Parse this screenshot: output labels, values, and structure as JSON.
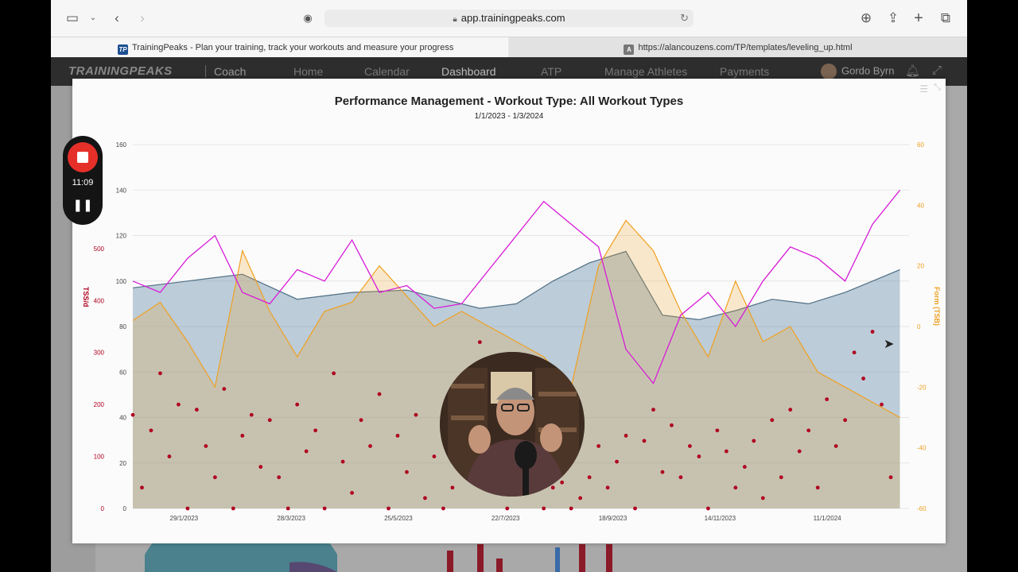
{
  "browser": {
    "url": "app.trainingpeaks.com",
    "tabs": [
      {
        "favicon": "TP",
        "title": "TrainingPeaks - Plan your training, track your workouts and measure your progress"
      },
      {
        "favicon": "A",
        "title": "https://alancouzens.com/TP/templates/leveling_up.html"
      }
    ],
    "icons": [
      "sidebar-icon",
      "chevron-down-icon",
      "back-icon",
      "forward-icon",
      "password-icon",
      "lock-icon",
      "reload-icon",
      "download-icon",
      "share-icon",
      "new-tab-icon",
      "tabs-overview-icon"
    ]
  },
  "app": {
    "logo": "TRAININGPEAKS",
    "section": "Coach",
    "nav": [
      "Home",
      "Calendar",
      "Dashboard",
      "ATP",
      "Manage Athletes",
      "Payments"
    ],
    "active_nav": "Dashboard",
    "user": "Gordo Byrn",
    "icons": [
      "bell-icon",
      "expand-icon"
    ]
  },
  "recorder": {
    "time": "11:09",
    "pause_glyph": "❚❚"
  },
  "chart_data": {
    "type": "line",
    "title": "Performance Management - Workout Type: All Workout Types",
    "subtitle": "1/1/2023 - 1/3/2024",
    "x_tick_labels": [
      "29/1/2023",
      "28/3/2023",
      "25/5/2023",
      "22/7/2023",
      "18/9/2023",
      "14/11/2023",
      "11/1/2024"
    ],
    "x_range": [
      "1/1/2023",
      "1/3/2024"
    ],
    "y_left_inner": {
      "ticks": [
        0,
        20,
        40,
        60,
        80,
        100,
        120,
        140,
        160
      ],
      "range": [
        0,
        160
      ]
    },
    "y_left_outer": {
      "label": "TSS/d",
      "ticks": [
        0,
        100,
        200,
        300,
        400,
        500
      ],
      "range": [
        0,
        700
      ],
      "color": "#b00020"
    },
    "y_right": {
      "label": "Form (TSB)",
      "ticks": [
        -60,
        -40,
        -20,
        0,
        20,
        40,
        60
      ],
      "range": [
        -60,
        60
      ],
      "color": "#f0a020"
    },
    "series": [
      {
        "kind": "fitness-area",
        "axis": "inner",
        "color": "#6f93ad",
        "x_days": [
          0,
          30,
          60,
          90,
          120,
          150,
          170,
          190,
          210,
          230,
          250,
          270,
          290,
          310,
          330,
          350,
          370,
          390,
          405,
          420
        ],
        "values": [
          97,
          100,
          103,
          92,
          95,
          96,
          92,
          88,
          90,
          100,
          108,
          113,
          85,
          83,
          87,
          92,
          90,
          95,
          100,
          105
        ]
      },
      {
        "kind": "fatigue-line",
        "axis": "inner",
        "color": "#d81bd8",
        "x_days": [
          0,
          15,
          30,
          45,
          60,
          75,
          90,
          105,
          120,
          135,
          150,
          165,
          180,
          195,
          210,
          225,
          240,
          255,
          270,
          285,
          300,
          315,
          330,
          345,
          360,
          375,
          390,
          405,
          420
        ],
        "values": [
          100,
          95,
          110,
          120,
          95,
          90,
          105,
          100,
          118,
          95,
          98,
          88,
          90,
          105,
          120,
          135,
          125,
          115,
          70,
          55,
          85,
          95,
          80,
          100,
          115,
          110,
          100,
          125,
          140
        ]
      },
      {
        "kind": "form-area",
        "axis": "right",
        "color": "#f0a020",
        "x_days": [
          0,
          15,
          30,
          45,
          60,
          75,
          90,
          105,
          120,
          135,
          150,
          165,
          180,
          195,
          210,
          225,
          240,
          255,
          270,
          285,
          300,
          315,
          330,
          345,
          360,
          375,
          390,
          405,
          420
        ],
        "values": [
          2,
          8,
          -5,
          -20,
          25,
          5,
          -10,
          5,
          8,
          20,
          10,
          0,
          5,
          0,
          -5,
          -10,
          -20,
          20,
          35,
          25,
          5,
          -10,
          15,
          -5,
          0,
          -15,
          -20,
          -25,
          -30
        ]
      },
      {
        "kind": "tss-dots",
        "axis": "outer",
        "color": "#b00020",
        "x_days": [
          0,
          5,
          10,
          15,
          20,
          25,
          30,
          35,
          40,
          45,
          50,
          55,
          60,
          65,
          70,
          75,
          80,
          85,
          90,
          95,
          100,
          105,
          110,
          115,
          120,
          125,
          130,
          135,
          140,
          145,
          150,
          155,
          160,
          165,
          170,
          175,
          180,
          185,
          190,
          195,
          200,
          205,
          210,
          215,
          220,
          225,
          230,
          235,
          240,
          245,
          250,
          255,
          260,
          265,
          270,
          275,
          280,
          285,
          290,
          295,
          300,
          305,
          310,
          315,
          320,
          325,
          330,
          335,
          340,
          345,
          350,
          355,
          360,
          365,
          370,
          375,
          380,
          385,
          390,
          395,
          400,
          405,
          410,
          415
        ],
        "values": [
          180,
          40,
          150,
          260,
          100,
          200,
          0,
          190,
          120,
          60,
          230,
          0,
          140,
          180,
          80,
          170,
          60,
          0,
          200,
          110,
          150,
          0,
          260,
          90,
          30,
          170,
          120,
          220,
          0,
          140,
          70,
          180,
          20,
          100,
          0,
          40,
          180,
          130,
          320,
          120,
          60,
          0,
          150,
          190,
          80,
          0,
          40,
          50,
          0,
          20,
          60,
          120,
          40,
          90,
          140,
          0,
          130,
          190,
          70,
          160,
          60,
          120,
          100,
          0,
          150,
          110,
          40,
          80,
          130,
          20,
          170,
          60,
          190,
          110,
          150,
          40,
          210,
          120,
          170,
          300,
          250,
          340,
          200,
          60
        ]
      }
    ]
  }
}
